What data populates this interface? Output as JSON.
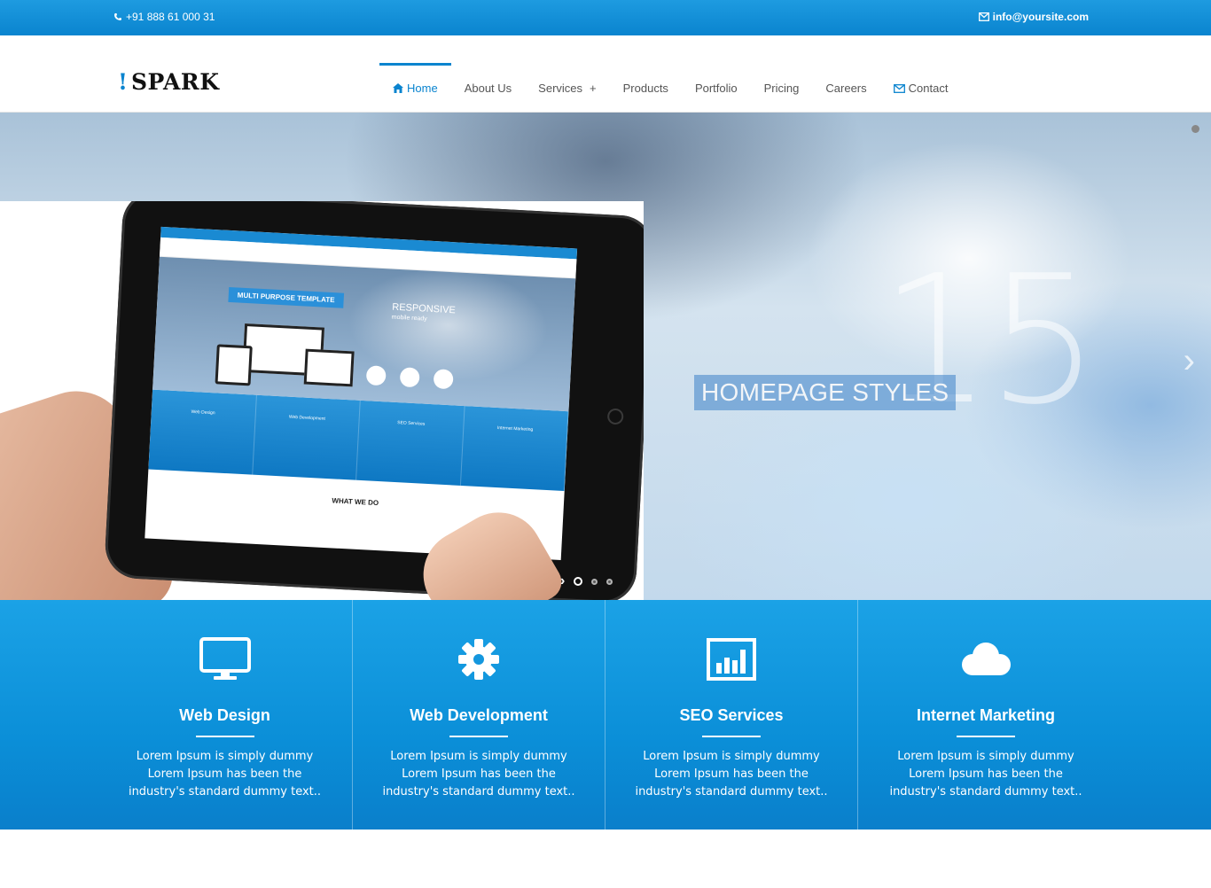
{
  "topbar": {
    "phone": "+91 888 61 000 31",
    "email": "info@yoursite.com"
  },
  "header": {
    "logo_mark": "!",
    "logo_text": "SPARK",
    "nav": [
      {
        "label": "Home",
        "icon": "home-icon",
        "active": true
      },
      {
        "label": "About Us"
      },
      {
        "label": "Services",
        "suffix": "+"
      },
      {
        "label": "Products"
      },
      {
        "label": "Portfolio"
      },
      {
        "label": "Pricing"
      },
      {
        "label": "Careers"
      },
      {
        "label": "Contact",
        "icon": "envelope-icon"
      }
    ]
  },
  "hero": {
    "big_number": "15",
    "caption": "HOMEPAGE STYLES",
    "inner_slider": {
      "badge": "MULTI PURPOSE TEMPLATE",
      "responsive_line1": "RESPONSIVE",
      "responsive_line2": "mobile ready",
      "section_title": "WHAT WE DO",
      "features": [
        "Web Design",
        "Web Development",
        "SEO Services",
        "Internet Marketing"
      ]
    }
  },
  "features": [
    {
      "icon": "monitor-icon",
      "title": "Web Design",
      "text": "Lorem Ipsum is simply dummy Lorem Ipsum has been the industry's standard dummy text.."
    },
    {
      "icon": "gear-icon",
      "title": "Web Development",
      "text": "Lorem Ipsum is simply dummy Lorem Ipsum has been the industry's standard dummy text.."
    },
    {
      "icon": "bar-chart-icon",
      "title": "SEO Services",
      "text": "Lorem Ipsum is simply dummy Lorem Ipsum has been the industry's standard dummy text.."
    },
    {
      "icon": "cloud-icon",
      "title": "Internet Marketing",
      "text": "Lorem Ipsum is simply dummy Lorem Ipsum has been the industry's standard dummy text.."
    }
  ],
  "colors": {
    "accent": "#0a84cf",
    "feature_bg": "#0b8fd8"
  }
}
